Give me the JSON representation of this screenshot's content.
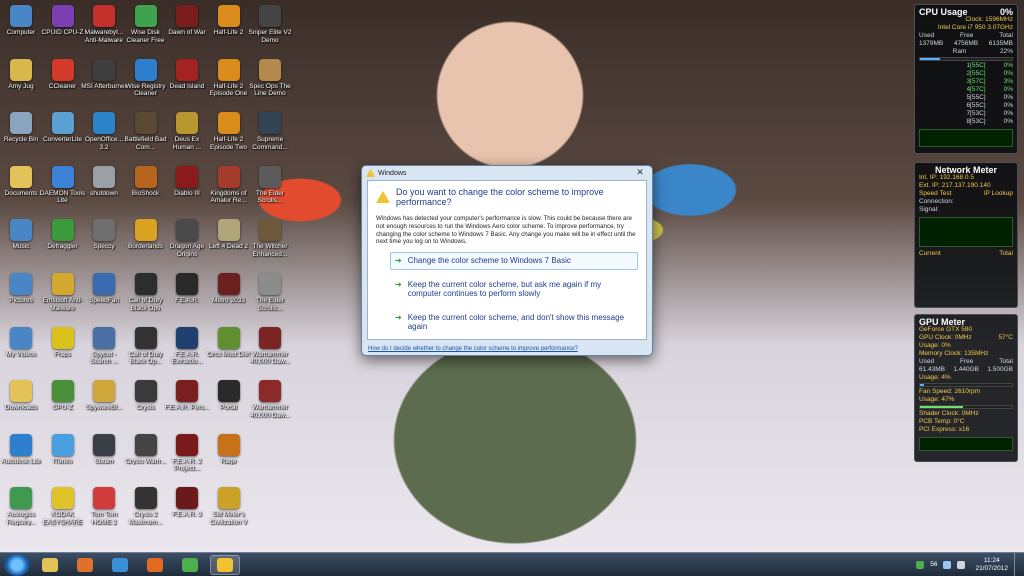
{
  "desktop_icons": [
    {
      "label": "Computer",
      "color": "#4a86c5",
      "col": 0,
      "row": 0
    },
    {
      "label": "CPUID CPU-Z",
      "color": "#7c3fb1",
      "col": 1,
      "row": 0
    },
    {
      "label": "Malwarebyt... Anti-Malware",
      "color": "#c4302b",
      "col": 2,
      "row": 0
    },
    {
      "label": "Wise Disk Cleaner Free",
      "color": "#3fa34d",
      "col": 3,
      "row": 0
    },
    {
      "label": "Dawn of War",
      "color": "#7a1d1d",
      "col": 4,
      "row": 0
    },
    {
      "label": "Half-Life 2",
      "color": "#d98b1c",
      "col": 5,
      "row": 0
    },
    {
      "label": "Sniper Elite V2 Demo",
      "color": "#444444",
      "col": 6,
      "row": 0
    },
    {
      "label": "Amy Jug",
      "color": "#d8b84c",
      "col": 0,
      "row": 1
    },
    {
      "label": "CCleaner",
      "color": "#d33a2a",
      "col": 1,
      "row": 1
    },
    {
      "label": "MSI Afterburner",
      "color": "#3e3e3e",
      "col": 2,
      "row": 1
    },
    {
      "label": "Wise Registry Cleaner",
      "color": "#2f7fcf",
      "col": 3,
      "row": 1
    },
    {
      "label": "Dead Island",
      "color": "#a32222",
      "col": 4,
      "row": 1
    },
    {
      "label": "Half-Life 2 Episode One",
      "color": "#d98b1c",
      "col": 5,
      "row": 1
    },
    {
      "label": "Spec Ops The Line Demo",
      "color": "#b18a4c",
      "col": 6,
      "row": 1
    },
    {
      "label": "Recycle Bin",
      "color": "#8aa4c0",
      "col": 0,
      "row": 2
    },
    {
      "label": "ConverterLite",
      "color": "#5aa0d0",
      "col": 1,
      "row": 2
    },
    {
      "label": "OpenOffice... 3.2",
      "color": "#2b84c9",
      "col": 2,
      "row": 2
    },
    {
      "label": "Battlefield Bad Com...",
      "color": "#5a4a33",
      "col": 3,
      "row": 2
    },
    {
      "label": "Deus Ex Human ...",
      "color": "#b9962f",
      "col": 4,
      "row": 2
    },
    {
      "label": "Half-Life 2 Episode Two",
      "color": "#d98b1c",
      "col": 5,
      "row": 2
    },
    {
      "label": "Supreme Command...",
      "color": "#334455",
      "col": 6,
      "row": 2
    },
    {
      "label": "Documents",
      "color": "#e4c25a",
      "col": 0,
      "row": 3
    },
    {
      "label": "DAEMON Tools Lite",
      "color": "#3b82d6",
      "col": 1,
      "row": 3
    },
    {
      "label": "shutdown",
      "color": "#9aa0a6",
      "col": 2,
      "row": 3
    },
    {
      "label": "BioShock",
      "color": "#b5651d",
      "col": 3,
      "row": 3
    },
    {
      "label": "Diablo III",
      "color": "#8b1a1a",
      "col": 4,
      "row": 3
    },
    {
      "label": "Kingdoms of Amalur Re...",
      "color": "#a43c2b",
      "col": 5,
      "row": 3
    },
    {
      "label": "The Elder Scrolls...",
      "color": "#5b5b5b",
      "col": 6,
      "row": 3
    },
    {
      "label": "Music",
      "color": "#4a86c5",
      "col": 0,
      "row": 4
    },
    {
      "label": "Defraggler",
      "color": "#3b9a3b",
      "col": 1,
      "row": 4
    },
    {
      "label": "Speccy",
      "color": "#6f6f6f",
      "col": 2,
      "row": 4
    },
    {
      "label": "Borderlands",
      "color": "#d9a321",
      "col": 3,
      "row": 4
    },
    {
      "label": "Dragon Age Origins",
      "color": "#4a4a4a",
      "col": 4,
      "row": 4
    },
    {
      "label": "Left 4 Dead 2",
      "color": "#b0a67a",
      "col": 5,
      "row": 4
    },
    {
      "label": "The Witcher Enhanced...",
      "color": "#6e5a3a",
      "col": 6,
      "row": 4
    },
    {
      "label": "Pictures",
      "color": "#4a86c5",
      "col": 0,
      "row": 5
    },
    {
      "label": "Emsisoft Anti-Malware",
      "color": "#d3a82f",
      "col": 1,
      "row": 5
    },
    {
      "label": "SpeedFan",
      "color": "#3a6ab0",
      "col": 2,
      "row": 5
    },
    {
      "label": "Call of Duty Black Ops",
      "color": "#2d2d2d",
      "col": 3,
      "row": 5
    },
    {
      "label": "F.E.A.R.",
      "color": "#2a2a2a",
      "col": 4,
      "row": 5
    },
    {
      "label": "Metro 2033",
      "color": "#6b2020",
      "col": 5,
      "row": 5
    },
    {
      "label": "The Elder Scrolls...",
      "color": "#8c8c8c",
      "col": 6,
      "row": 5
    },
    {
      "label": "My Videos",
      "color": "#4a86c5",
      "col": 0,
      "row": 6
    },
    {
      "label": "Fraps",
      "color": "#d9c21c",
      "col": 1,
      "row": 6
    },
    {
      "label": "Spybot - Search ...",
      "color": "#4a6fa5",
      "col": 2,
      "row": 6
    },
    {
      "label": "Call of Duty Black Op...",
      "color": "#333333",
      "col": 3,
      "row": 6
    },
    {
      "label": "F.E.A.R. Extractio...",
      "color": "#1f3f6f",
      "col": 4,
      "row": 6
    },
    {
      "label": "Orcs Must Die!",
      "color": "#5f8f2f",
      "col": 5,
      "row": 6
    },
    {
      "label": "Warhammer 40,000 Daw...",
      "color": "#7a2424",
      "col": 6,
      "row": 6
    },
    {
      "label": "Downloads",
      "color": "#e4c25a",
      "col": 0,
      "row": 7
    },
    {
      "label": "GPU-Z",
      "color": "#4a8f3a",
      "col": 1,
      "row": 7
    },
    {
      "label": "SpywareBl...",
      "color": "#cfa73a",
      "col": 2,
      "row": 7
    },
    {
      "label": "Crysis",
      "color": "#3a3a3a",
      "col": 3,
      "row": 7
    },
    {
      "label": "F.E.A.R. Pers...",
      "color": "#7a1f1f",
      "col": 4,
      "row": 7
    },
    {
      "label": "Portal",
      "color": "#2a2a2a",
      "col": 5,
      "row": 7
    },
    {
      "label": "Warhammer 40,000 Daw...",
      "color": "#8c2a2a",
      "col": 6,
      "row": 7
    },
    {
      "label": "Autodesk Lite",
      "color": "#2f7fcf",
      "col": 0,
      "row": 8
    },
    {
      "label": "iTunes",
      "color": "#4a9fe0",
      "col": 1,
      "row": 8
    },
    {
      "label": "Steam",
      "color": "#3a3f47",
      "col": 2,
      "row": 8
    },
    {
      "label": "Crysis Warh...",
      "color": "#444444",
      "col": 3,
      "row": 8
    },
    {
      "label": "F.E.A.R. 2 Project...",
      "color": "#7a1a1a",
      "col": 4,
      "row": 8
    },
    {
      "label": "Rage",
      "color": "#c7721a",
      "col": 5,
      "row": 8
    },
    {
      "label": "Auslogics Registry...",
      "color": "#3f9a4f",
      "col": 0,
      "row": 9
    },
    {
      "label": "KODAK EASYSHARE Home Center",
      "color": "#e0c22b",
      "col": 1,
      "row": 9
    },
    {
      "label": "Tom Tom HOME 2",
      "color": "#d23b3b",
      "col": 2,
      "row": 9
    },
    {
      "label": "Crysis 2 Maximum...",
      "color": "#333333",
      "col": 3,
      "row": 9
    },
    {
      "label": "F.E.A.R. 3",
      "color": "#6a1a1a",
      "col": 4,
      "row": 9
    },
    {
      "label": "Sid Meier's Civilization V",
      "color": "#c9a227",
      "col": 5,
      "row": 9
    }
  ],
  "cpu_gadget": {
    "title": "CPU Usage",
    "percent": "0%",
    "clock": "Clock: 1596MHz",
    "model": "Intel Core i7 950 3.07GHz",
    "mem_headers": [
      "Used",
      "Free",
      "Total"
    ],
    "mem_values": [
      "1379MB",
      "4756MB",
      "6135MB"
    ],
    "ram_label": "Ram",
    "ram_percent": "22%",
    "ram_fill": 0.22,
    "cores": [
      {
        "label": "1[55C]",
        "value": "0%"
      },
      {
        "label": "2[55C]",
        "value": "0%"
      },
      {
        "label": "3[57C]",
        "value": "3%"
      },
      {
        "label": "4[57C]",
        "value": "0%"
      },
      {
        "label": "5[55C]",
        "value": "0%"
      },
      {
        "label": "6[55C]",
        "value": "0%"
      },
      {
        "label": "7[53C]",
        "value": "0%"
      },
      {
        "label": "8[53C]",
        "value": "0%"
      }
    ]
  },
  "net_gadget": {
    "title": "Network Meter",
    "int_ip": "Int. IP: 192.168.0.5",
    "ext_ip": "Ext. IP: 217.137.190.140",
    "speed_test": "Speed Test",
    "ip_lookup": "IP Lookup",
    "connection": "Connection:",
    "signal": "Signal:",
    "current": "Current",
    "total": "Total"
  },
  "gpu_gadget": {
    "title": "GPU Meter",
    "model": "GeForce GTX 580",
    "gpu_clock": "GPU Clock: 0MHz",
    "temp": "57°C",
    "usage1": "Usage: 0%",
    "mem_clock": "Memory Clock: 135MHz",
    "mem_headers": [
      "Used",
      "Free",
      "Total"
    ],
    "mem_values": [
      "61.43MB",
      "1.440GB",
      "1.500GB"
    ],
    "usage2": "Usage: 4%",
    "usage2_fill": 0.04,
    "fan": "Fan Speed: 2610rpm",
    "usage3": "Usage: 47%",
    "usage3_fill": 0.47,
    "shader": "Shader Clock: 0MHz",
    "pcb": "PCB Temp: 0°C",
    "pci": "PCI Express: x16"
  },
  "dialog": {
    "window_title": "Windows",
    "close_glyph": "✕",
    "question": "Do you want to change the color scheme to improve performance?",
    "description": "Windows has detected your computer's performance is slow. This could be because there are not enough resources to run the Windows Aero color scheme. To improve performance, try changing the color scheme to Windows 7 Basic. Any change you make will be in effect until the next time you log on to Windows.",
    "options": [
      "Change the color scheme to Windows 7 Basic",
      "Keep the current color scheme, but ask me again if my computer continues to perform slowly",
      "Keep the current color scheme, and don't show this message again"
    ],
    "help_link": "How do I decide whether to change the color scheme to improve performance?"
  },
  "taskbar": {
    "pinned": [
      {
        "name": "explorer",
        "color": "#e4c25a"
      },
      {
        "name": "media-player",
        "color": "#e0702a"
      },
      {
        "name": "internet-explorer",
        "color": "#3a8fd6"
      },
      {
        "name": "firefox",
        "color": "#e06a1f"
      },
      {
        "name": "chrome",
        "color": "#4caf50"
      },
      {
        "name": "warning",
        "color": "#f2c230"
      }
    ],
    "tray_number": "56",
    "time": "11:24",
    "date": "21/07/2012"
  }
}
